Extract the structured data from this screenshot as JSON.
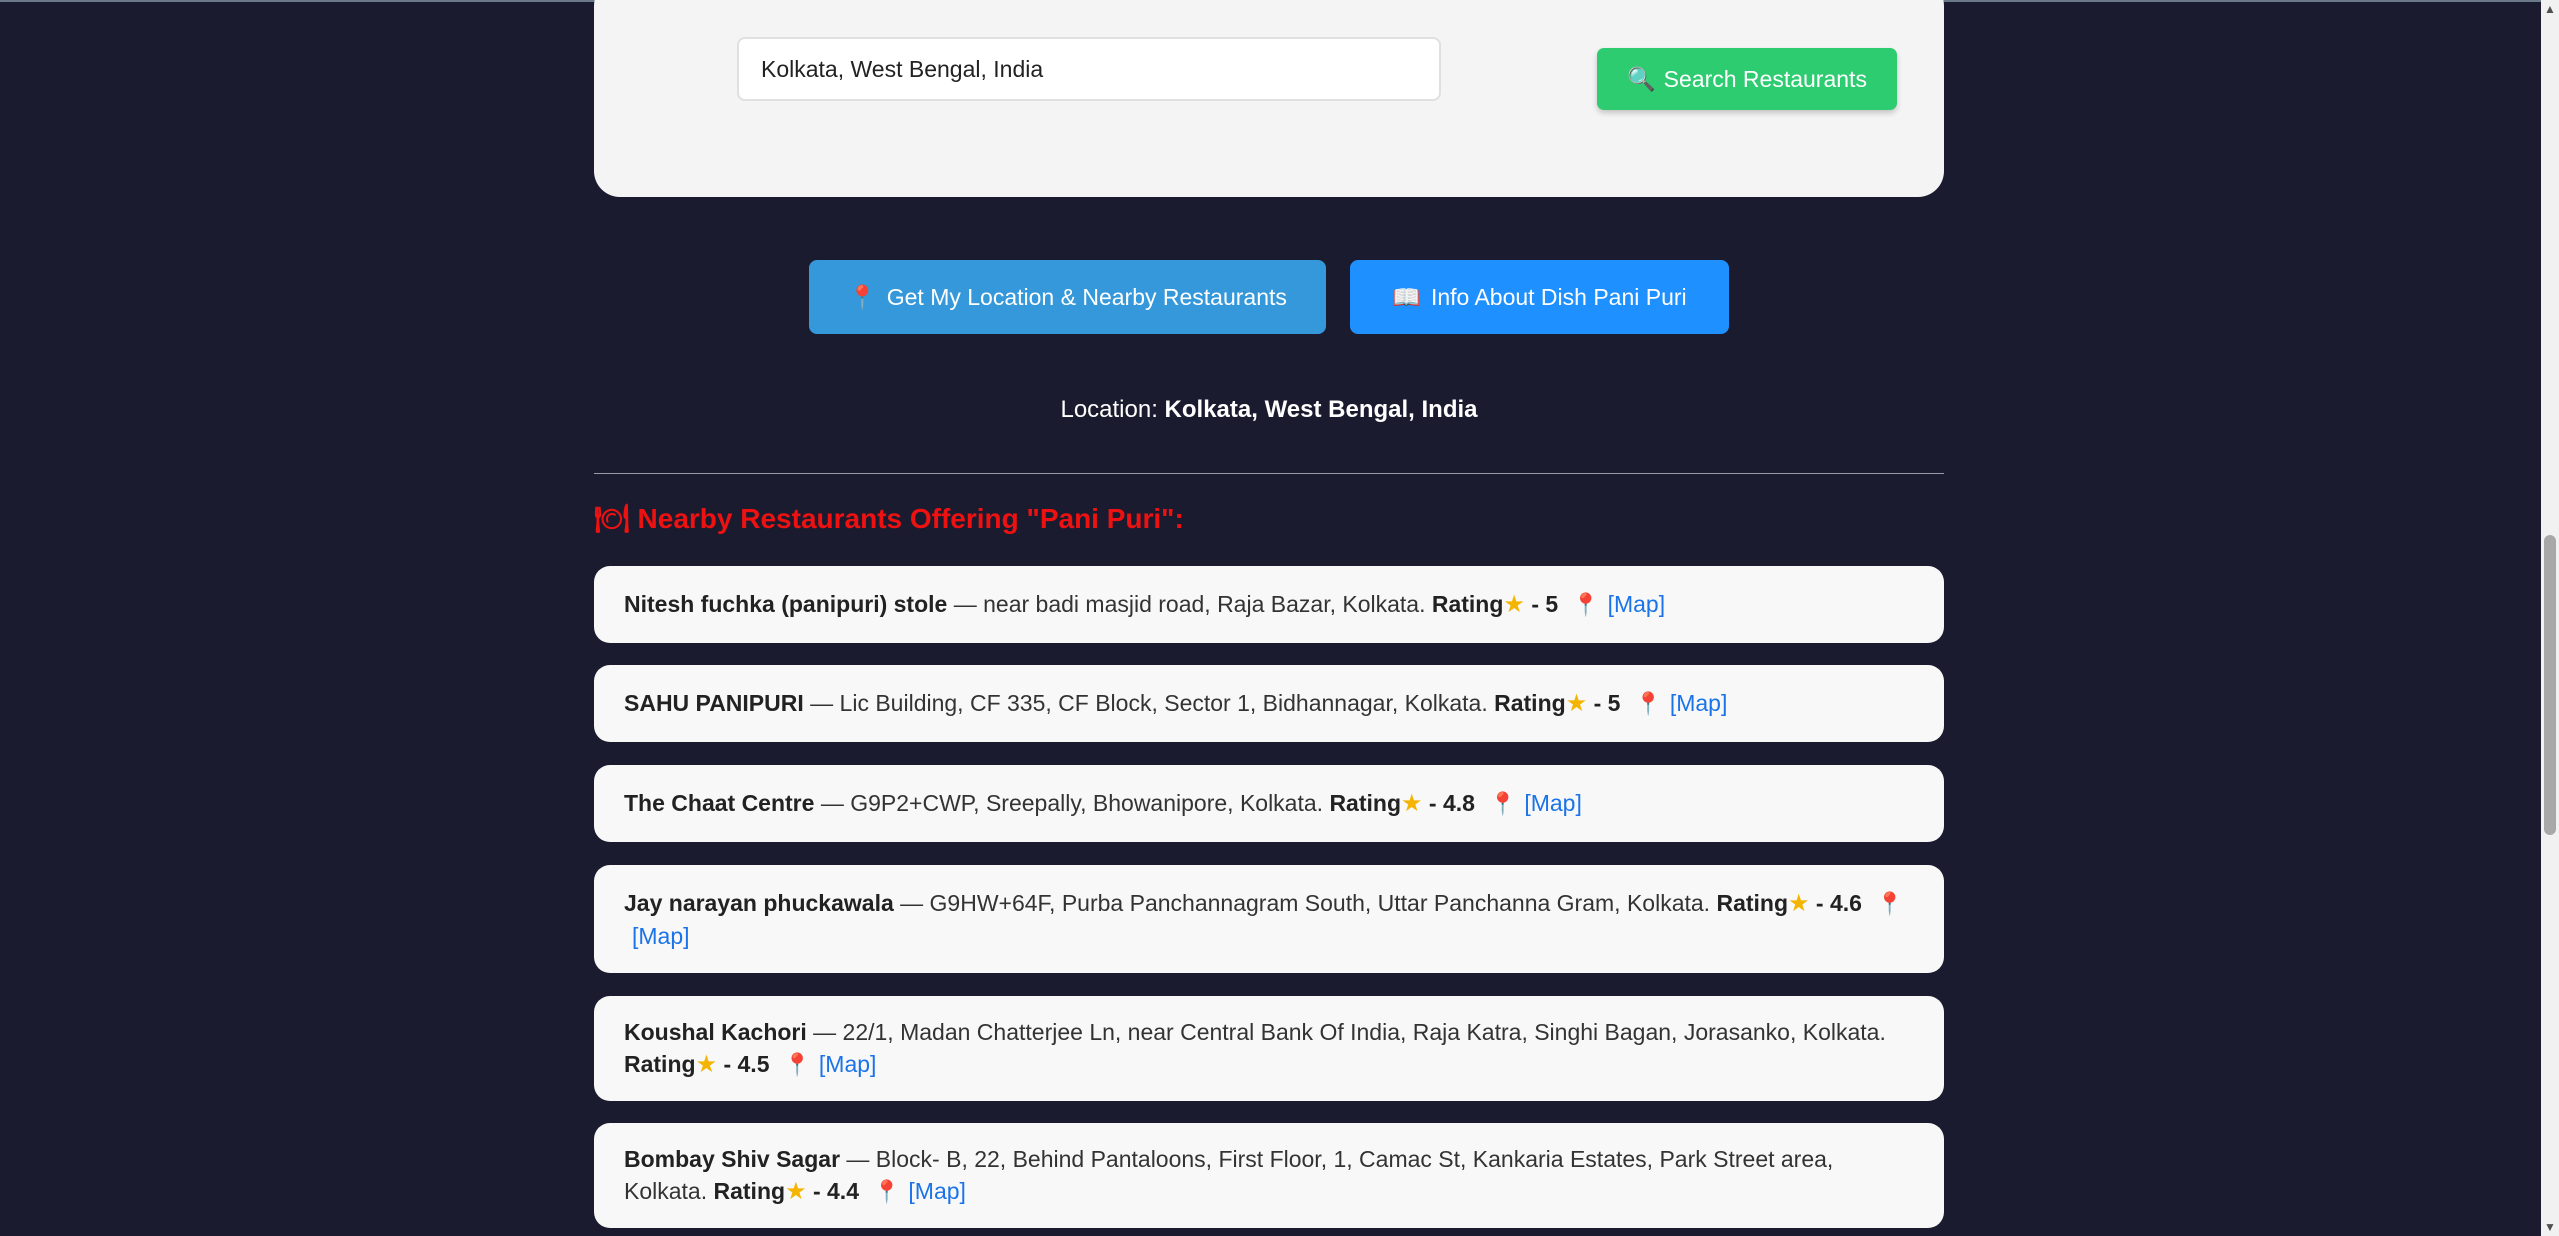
{
  "search": {
    "value": "Kolkata, West Bengal, India",
    "button_icon": "🔍",
    "button_label": "Search Restaurants"
  },
  "actions": {
    "location_icon": "📍",
    "location_label": "Get My Location & Nearby Restaurants",
    "info_icon": "📖",
    "info_label": "Info About Dish Pani Puri"
  },
  "location": {
    "prefix": "Location:",
    "value": "Kolkata, West Bengal, India"
  },
  "heading": {
    "icon": "🍽",
    "text": "Nearby Restaurants Offering \"Pani Puri\":"
  },
  "restaurants": [
    {
      "name": "Nitesh fuchka (panipuri) stole",
      "address": " — near badi masjid road, Raja Bazar, Kolkata. ",
      "rating_label": "Rating",
      "rating": " - 5",
      "map": "[Map]"
    },
    {
      "name": "SAHU PANIPURI",
      "address": " — Lic Building, CF 335, CF Block, Sector 1, Bidhannagar, Kolkata. ",
      "rating_label": "Rating",
      "rating": " - 5",
      "map": "[Map]"
    },
    {
      "name": "The Chaat Centre",
      "address": " — G9P2+CWP, Sreepally, Bhowanipore, Kolkata. ",
      "rating_label": "Rating",
      "rating": " - 4.8",
      "map": "[Map]"
    },
    {
      "name": "Jay narayan phuckawala",
      "address": " — G9HW+64F, Purba Panchannagram South, Uttar Panchanna Gram, Kolkata. ",
      "rating_label": "Rating",
      "rating": " - 4.6",
      "map": "[Map]"
    },
    {
      "name": "Koushal Kachori",
      "address": " — 22/1, Madan Chatterjee Ln, near Central Bank Of India, Raja Katra, Singhi Bagan, Jorasanko, Kolkata. ",
      "rating_label": "Rating",
      "rating": " - 4.5",
      "map": "[Map]"
    },
    {
      "name": "Bombay Shiv Sagar",
      "address": " — Block- B, 22, Behind Pantaloons, First Floor, 1, Camac St, Kankaria Estates, Park Street area, Kolkata. ",
      "rating_label": "Rating",
      "rating": " - 4.4",
      "map": "[Map]"
    }
  ],
  "icons": {
    "star": "star-icon",
    "pin": "map-pin-icon"
  },
  "colors": {
    "background": "#1b1b2f",
    "search_button": "#2ecc71",
    "location_button": "#3498db",
    "info_button": "#1e90ff",
    "heading": "#ee1111",
    "link": "#1a73e8"
  }
}
